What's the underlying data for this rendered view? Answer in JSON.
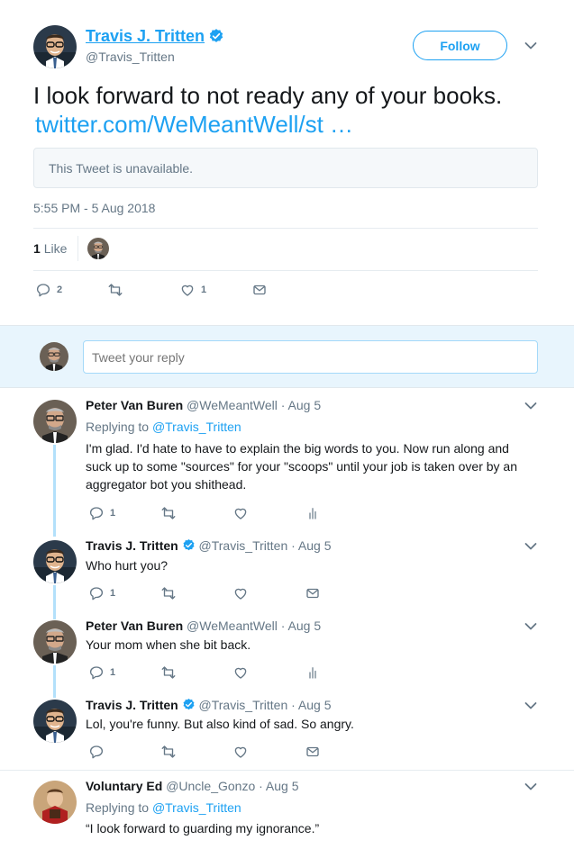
{
  "main_tweet": {
    "author_name": "Travis J. Tritten",
    "author_handle": "@Travis_Tritten",
    "follow_label": "Follow",
    "text": "I look forward to not ready any of your books.",
    "link_text": "twitter.com/WeMeantWell/st …",
    "quoted_unavailable": "This Tweet is unavailable.",
    "timestamp": "5:55 PM - 5 Aug 2018",
    "likes_count": "1",
    "likes_label": "Like",
    "reply_count": "2",
    "like_count": "1"
  },
  "reply_box": {
    "placeholder": "Tweet your reply"
  },
  "replies": [
    {
      "name": "Peter Van Buren",
      "handle": "@WeMeantWell",
      "date": "· Aug 5",
      "replying_prefix": "Replying to",
      "replying_to": "@Travis_Tritten",
      "text": "I'm glad. I'd hate to have to explain the big words to you. Now run along and suck up to some \"sources\" for your \"scoops\" until your job is taken over by an aggregator bot you shithead.",
      "reply_count": "1"
    },
    {
      "name": "Travis J. Tritten",
      "handle": "@Travis_Tritten",
      "date": "· Aug 5",
      "text": "Who hurt you?",
      "reply_count": "1"
    },
    {
      "name": "Peter Van Buren",
      "handle": "@WeMeantWell",
      "date": "· Aug 5",
      "text": "Your mom when she bit back.",
      "reply_count": "1"
    },
    {
      "name": "Travis J. Tritten",
      "handle": "@Travis_Tritten",
      "date": "· Aug 5",
      "text": "Lol, you're funny. But also kind of sad. So angry.",
      "reply_count": ""
    },
    {
      "name": "Voluntary Ed",
      "handle": "@Uncle_Gonzo",
      "date": "· Aug 5",
      "replying_prefix": "Replying to",
      "replying_to": "@Travis_Tritten",
      "text": "“I look forward to guarding my ignorance.”"
    }
  ],
  "colors": {
    "accent": "#1da1f2",
    "muted": "#657786",
    "border": "#e6ecf0",
    "verified": "#1da1f2"
  }
}
